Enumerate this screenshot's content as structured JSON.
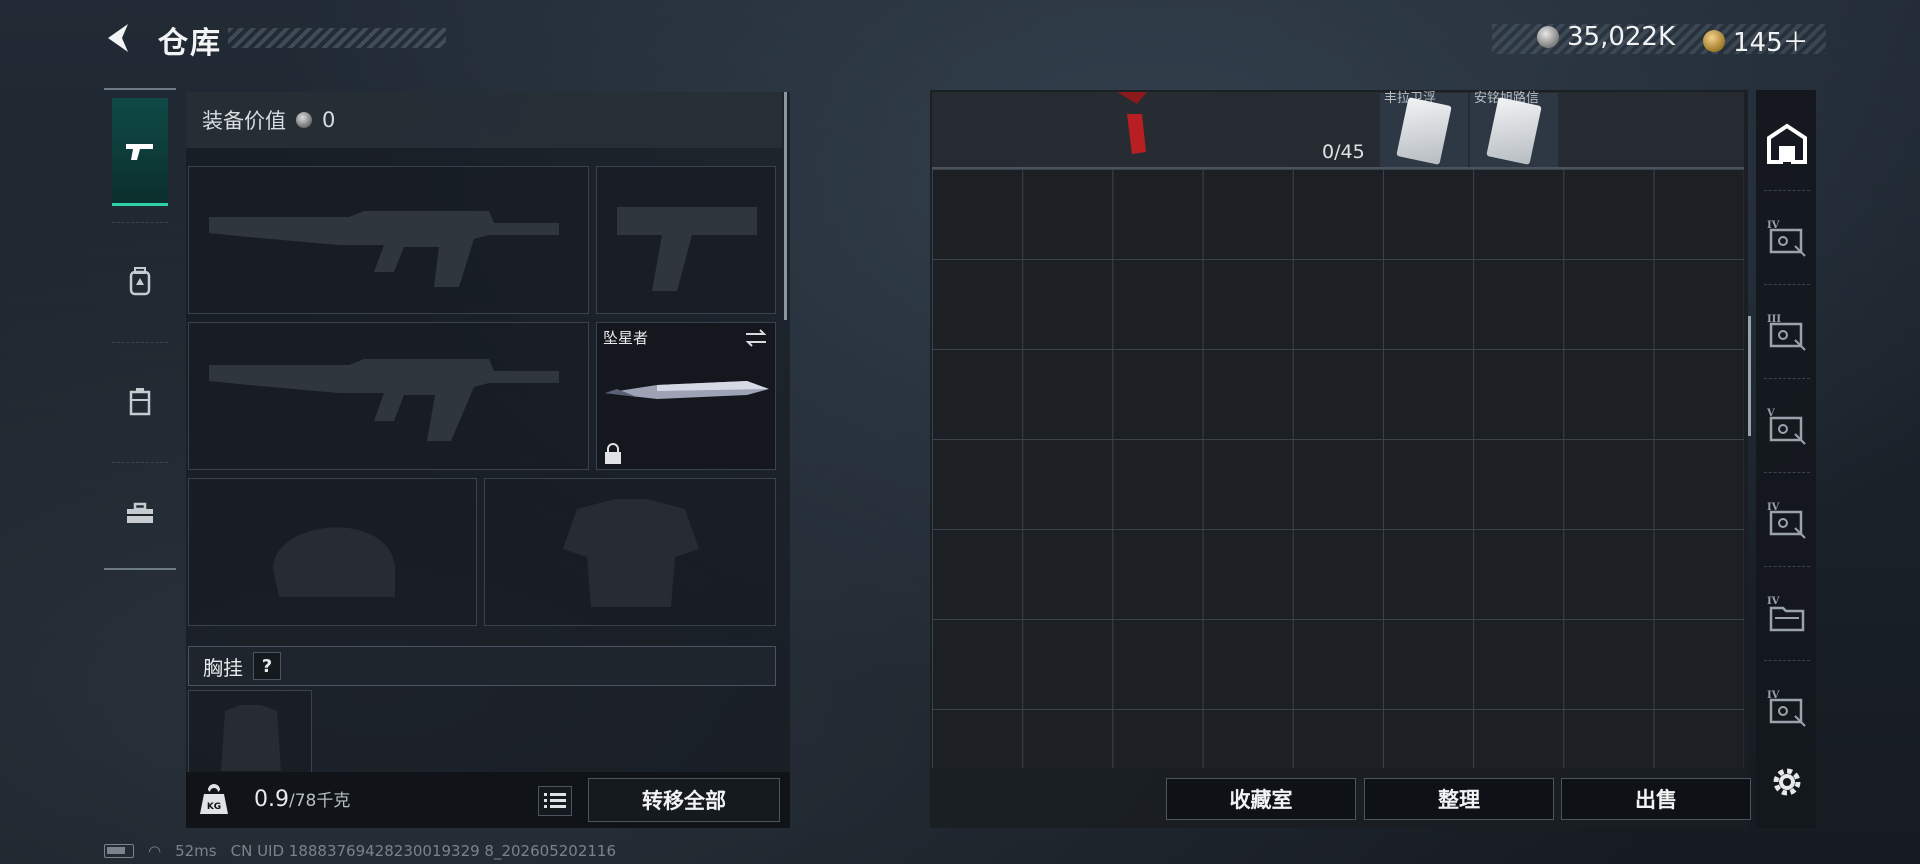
{
  "header": {
    "title": "仓库",
    "currency_silver": "35,022K",
    "currency_gold": "145＋"
  },
  "left_nav": {
    "items": [
      {
        "name": "weapons",
        "icon": "pistol-icon",
        "active": true
      },
      {
        "name": "armor",
        "icon": "backpack-icon",
        "active": false
      },
      {
        "name": "container",
        "icon": "case-icon",
        "active": false
      },
      {
        "name": "tools",
        "icon": "toolbox-icon",
        "active": false
      }
    ]
  },
  "equipment": {
    "value_label": "装备价值",
    "value": "0",
    "melee_name": "坠星者",
    "chest_rig_label": "胸挂",
    "help_label": "?"
  },
  "weight": {
    "current": "0.9",
    "max_label": "/78千克"
  },
  "actions": {
    "transfer_all": "转移全部",
    "collection": "收藏室",
    "organize": "整理",
    "sell": "出售"
  },
  "stash": {
    "count": "0/45",
    "cards": [
      {
        "caption": "丰拉卫浮"
      },
      {
        "caption": "安铭旭路信"
      }
    ]
  },
  "right_nav": {
    "items": [
      {
        "icon": "stash-icon",
        "label": ""
      },
      {
        "icon": "safe-iv-icon",
        "label": "IV"
      },
      {
        "icon": "safe-iii-icon",
        "label": "III"
      },
      {
        "icon": "safe-v-icon",
        "label": "V"
      },
      {
        "icon": "safe-iv-icon",
        "label": "IV"
      },
      {
        "icon": "folder-iv-icon",
        "label": "IV"
      },
      {
        "icon": "safe-iv-icon",
        "label": "IV"
      }
    ]
  },
  "status_bar": {
    "ping": "52ms",
    "uid": "CN UID 18883769428230019329 8_202605202116"
  },
  "colors": {
    "accent": "#2fd2a8",
    "panel": "#181d23",
    "border": "#4a5561"
  }
}
